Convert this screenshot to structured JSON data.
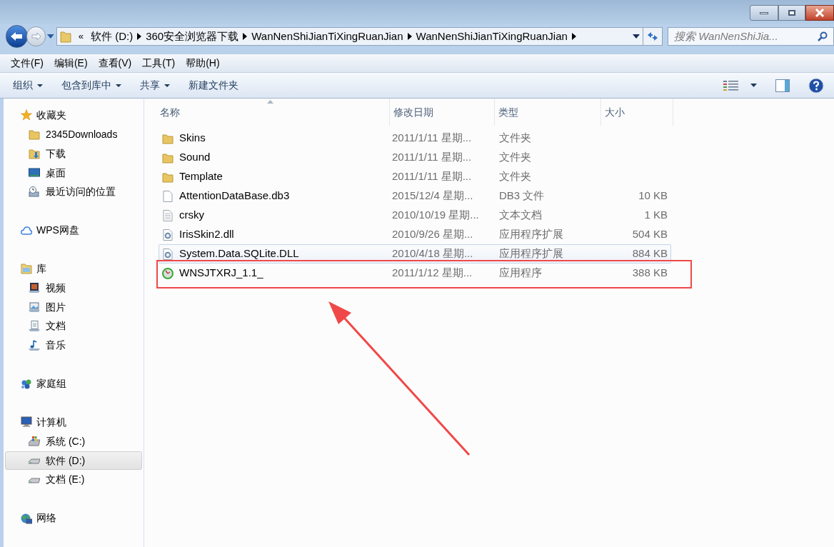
{
  "address_bar": {
    "overflow": "«",
    "crumbs": [
      "软件 (D:)",
      "360安全浏览器下载",
      "WanNenShiJianTiXingRuanJian",
      "WanNenShiJianTiXingRuanJian"
    ]
  },
  "search": {
    "placeholder": "搜索 WanNenShiJia..."
  },
  "menu": [
    "文件(F)",
    "编辑(E)",
    "查看(V)",
    "工具(T)",
    "帮助(H)"
  ],
  "toolbar": [
    {
      "label": "组织",
      "dropdown": true
    },
    {
      "label": "包含到库中",
      "dropdown": true
    },
    {
      "label": "共享",
      "dropdown": true
    },
    {
      "label": "新建文件夹",
      "dropdown": false
    }
  ],
  "sidebar": [
    {
      "label": "收藏夹",
      "kind": "star",
      "selected": false,
      "children": [
        {
          "label": "2345Downloads",
          "kind": "folder",
          "selected": false
        },
        {
          "label": "下载",
          "kind": "download",
          "selected": false
        },
        {
          "label": "桌面",
          "kind": "desktop",
          "selected": false
        },
        {
          "label": "最近访问的位置",
          "kind": "recent",
          "selected": false
        }
      ]
    },
    {
      "label": "WPS网盘",
      "kind": "cloud",
      "selected": false
    },
    {
      "label": "库",
      "kind": "library",
      "selected": false,
      "children": [
        {
          "label": "视频",
          "kind": "video",
          "selected": false
        },
        {
          "label": "图片",
          "kind": "pictures",
          "selected": false
        },
        {
          "label": "文档",
          "kind": "documents",
          "selected": false
        },
        {
          "label": "音乐",
          "kind": "music",
          "selected": false
        }
      ]
    },
    {
      "label": "家庭组",
      "kind": "homegroup",
      "selected": false
    },
    {
      "label": "计算机",
      "kind": "computer",
      "selected": false,
      "children": [
        {
          "label": "系统 (C:)",
          "kind": "system-drive",
          "selected": false
        },
        {
          "label": "软件 (D:)",
          "kind": "drive",
          "selected": true
        },
        {
          "label": "文档 (E:)",
          "kind": "drive",
          "selected": false
        }
      ]
    },
    {
      "label": "网络",
      "kind": "network",
      "selected": false
    }
  ],
  "table": {
    "columns": [
      "名称",
      "修改日期",
      "类型",
      "大小"
    ],
    "rows": [
      {
        "name": "Skins",
        "date": "2011/1/11 星期...",
        "type": "文件夹",
        "kind": "folder",
        "hover": false,
        "highlighted": false
      },
      {
        "name": "Sound",
        "date": "2011/1/11 星期...",
        "type": "文件夹",
        "kind": "folder",
        "hover": false,
        "highlighted": false
      },
      {
        "name": "Template",
        "date": "2011/1/11 星期...",
        "type": "文件夹",
        "kind": "folder",
        "hover": false,
        "highlighted": false
      },
      {
        "name": "AttentionDataBase.db3",
        "date": "2015/12/4 星期...",
        "type": "DB3 文件",
        "size": "10 KB",
        "kind": "file",
        "hover": false,
        "highlighted": false
      },
      {
        "name": "crsky",
        "date": "2010/10/19 星期...",
        "type": "文本文档",
        "size": "1 KB",
        "kind": "text",
        "hover": false,
        "highlighted": false
      },
      {
        "name": "IrisSkin2.dll",
        "date": "2010/9/26 星期...",
        "type": "应用程序扩展",
        "size": "504 KB",
        "kind": "dll",
        "hover": false,
        "highlighted": false
      },
      {
        "name": "System.Data.SQLite.DLL",
        "date": "2010/4/18 星期...",
        "type": "应用程序扩展",
        "size": "884 KB",
        "kind": "dll",
        "hover": true,
        "highlighted": false
      },
      {
        "name": "WNSJTXRJ_1.1_",
        "date": "2011/1/12 星期...",
        "type": "应用程序",
        "size": "388 KB",
        "kind": "app",
        "hover": false,
        "highlighted": true
      }
    ]
  }
}
